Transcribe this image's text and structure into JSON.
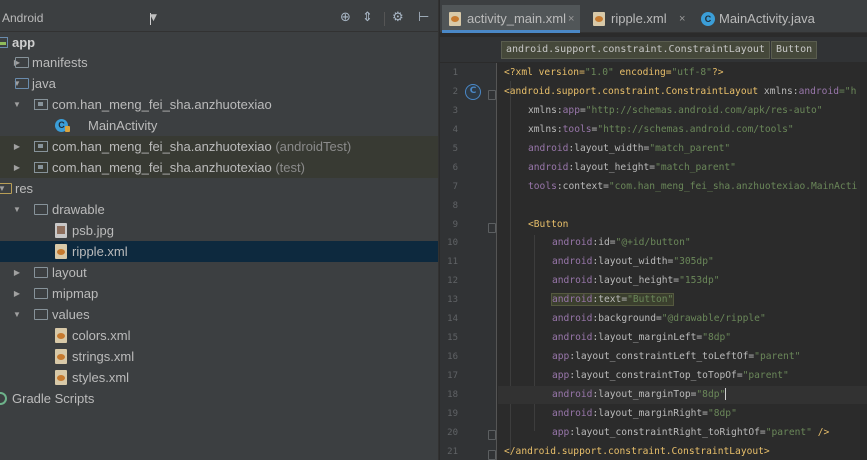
{
  "project_panel": {
    "view_mode": "Android",
    "toolbar_icons": [
      "locate-icon",
      "collapse-icon",
      "settings-icon",
      "hide-icon"
    ],
    "tree": [
      {
        "label": "app",
        "icon": "app-module-icon",
        "expanded": true,
        "bold": true
      },
      {
        "label": "manifests",
        "icon": "folder-icon"
      },
      {
        "label": "java",
        "icon": "source-folder-icon",
        "expanded": true
      },
      {
        "label": "com.han_meng_fei_sha.anzhuotexiao",
        "icon": "package-icon",
        "expanded": true
      },
      {
        "label": "MainActivity",
        "icon": "class-icon"
      },
      {
        "label": "com.han_meng_fei_sha.anzhuotexiao",
        "suffix": "(androidTest)",
        "icon": "package-icon"
      },
      {
        "label": "com.han_meng_fei_sha.anzhuotexiao",
        "suffix": "(test)",
        "icon": "package-icon"
      },
      {
        "label": "res",
        "icon": "resource-folder-icon",
        "expanded": true
      },
      {
        "label": "drawable",
        "icon": "folder-icon",
        "expanded": true
      },
      {
        "label": "psb.jpg",
        "icon": "image-file-icon"
      },
      {
        "label": "ripple.xml",
        "icon": "xml-file-icon",
        "selected": true
      },
      {
        "label": "layout",
        "icon": "folder-icon"
      },
      {
        "label": "mipmap",
        "icon": "folder-icon"
      },
      {
        "label": "values",
        "icon": "folder-icon",
        "expanded": true
      },
      {
        "label": "colors.xml",
        "icon": "xml-file-icon"
      },
      {
        "label": "strings.xml",
        "icon": "xml-file-icon"
      },
      {
        "label": "styles.xml",
        "icon": "xml-file-icon"
      },
      {
        "label": "Gradle Scripts",
        "icon": "gradle-icon"
      }
    ]
  },
  "editor": {
    "tabs": [
      {
        "label": "activity_main.xml",
        "icon": "xml-file-icon",
        "active": true
      },
      {
        "label": "ripple.xml",
        "icon": "xml-file-icon"
      },
      {
        "label": "MainActivity.java",
        "icon": "class-icon"
      }
    ],
    "close_glyph": "×",
    "breadcrumbs": [
      "android.support.constraint.ConstraintLayout",
      "Button"
    ],
    "line_numbers": [
      "1",
      "2",
      "3",
      "4",
      "5",
      "6",
      "7",
      "8",
      "9",
      "10",
      "11",
      "12",
      "13",
      "14",
      "15",
      "16",
      "17",
      "18",
      "19",
      "20",
      "21"
    ],
    "code": {
      "l1": {
        "a": "<?xml version=",
        "b": "\"1.0\"",
        "c": " encoding=",
        "d": "\"utf-8\"",
        "e": "?>"
      },
      "l2": {
        "a": "<android.support.constraint.ConstraintLayout ",
        "b": "xmlns:",
        "c": "android",
        "d": "=\"h"
      },
      "l3": {
        "a": "xmlns:",
        "b": "app",
        "c": "=",
        "d": "\"http://schemas.android.com/apk/res-auto\""
      },
      "l4": {
        "a": "xmlns:",
        "b": "tools",
        "c": "=",
        "d": "\"http://schemas.android.com/tools\""
      },
      "l5": {
        "a": "android",
        "b": ":layout_width=",
        "c": "\"match_parent\""
      },
      "l6": {
        "a": "android",
        "b": ":layout_height=",
        "c": "\"match_parent\""
      },
      "l7": {
        "a": "tools",
        "b": ":context=",
        "c": "\"com.han_meng_fei_sha.anzhuotexiao.MainActi"
      },
      "l9": {
        "a": "<Button"
      },
      "l10": {
        "a": "android",
        "b": ":id=",
        "c": "\"@+id/button\""
      },
      "l11": {
        "a": "android",
        "b": ":layout_width=",
        "c": "\"305dp\""
      },
      "l12": {
        "a": "android",
        "b": ":layout_height=",
        "c": "\"153dp\""
      },
      "l13": {
        "a": "android",
        "b": ":text=",
        "c": "\"Button\""
      },
      "l14": {
        "a": "android",
        "b": ":background=",
        "c": "\"@drawable/ripple\""
      },
      "l15": {
        "a": "android",
        "b": ":layout_marginLeft=",
        "c": "\"8dp\""
      },
      "l16": {
        "a": "app",
        "b": ":layout_constraintLeft_toLeftOf=",
        "c": "\"parent\""
      },
      "l17": {
        "a": "app",
        "b": ":layout_constraintTop_toTopOf=",
        "c": "\"parent\""
      },
      "l18": {
        "a": "android",
        "b": ":layout_marginTop=",
        "c": "\"8dp\""
      },
      "l19": {
        "a": "android",
        "b": ":layout_marginRight=",
        "c": "\"8dp\""
      },
      "l20": {
        "a": "app",
        "b": ":layout_constraintRight_toRightOf=",
        "c": "\"parent\"",
        "d": " />"
      },
      "l21": {
        "a": "</android.support.constraint.ConstraintLayout>"
      }
    },
    "gutter_markers": {
      "class_marker": "C"
    }
  },
  "colors": {
    "panel_bg": "#3c3f41",
    "editor_bg": "#2b2b2b",
    "selection": "#0d293e",
    "tag": "#e8bf6a",
    "namespace": "#9876aa",
    "string": "#6a8759"
  }
}
